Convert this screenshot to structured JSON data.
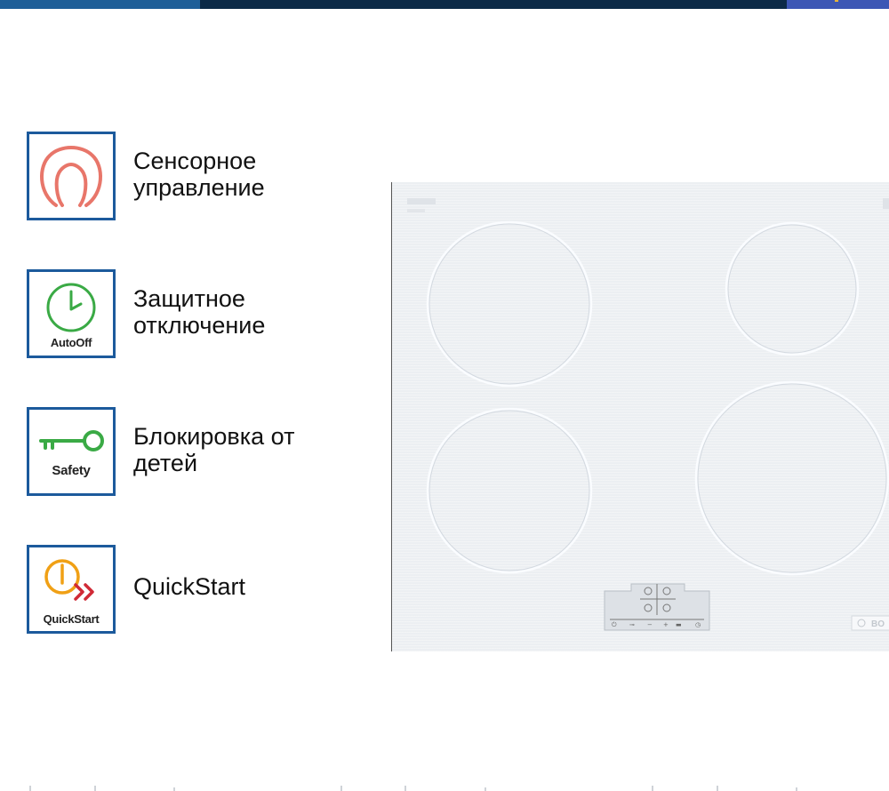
{
  "features": [
    {
      "label": "Сенсорное\nуправление",
      "icon": "touch-control-icon",
      "color": "#e8766a"
    },
    {
      "label": "Защитное\nотключение",
      "icon": "autooff-clock-icon",
      "caption": "AutoOff",
      "color": "#3aaa45"
    },
    {
      "label": "Блокировка от\nдетей",
      "icon": "safety-key-icon",
      "caption": "Safety",
      "color": "#3aaa45"
    },
    {
      "label": "QuickStart",
      "icon": "quickstart-power-icon",
      "caption": "QuickStart",
      "color": "#f0a015"
    }
  ],
  "cooktop": {
    "brand": "BOSCH",
    "burners": 4,
    "control_panel_symbols": [
      "⏻",
      "⊸",
      "−",
      "+",
      "boost",
      "◷"
    ]
  },
  "colors": {
    "frame_blue": "#1c5a9c",
    "topbar_dark": "#0c2a47"
  }
}
